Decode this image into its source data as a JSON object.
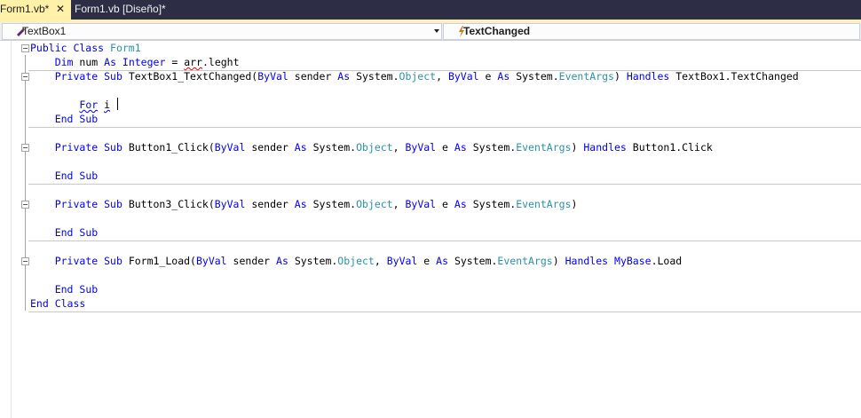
{
  "tabs": [
    {
      "label": "Form1.vb*",
      "active": true,
      "close": "✕"
    },
    {
      "label": "Form1.vb [Diseño]*",
      "active": false
    }
  ],
  "navbar": {
    "object_combo": "TextBox1",
    "event_combo": "TextChanged"
  },
  "colors": {
    "tab_active": "#fff1a8",
    "tabstrip": "#2d2d45",
    "keyword": "#0000ff",
    "type": "#2b91af"
  },
  "code": {
    "l1": {
      "kw": "Public Class",
      "ty": "Form1"
    },
    "l2": {
      "kw1": "Dim",
      "id1": "num",
      "kw2": "As Integer",
      "eq": "=",
      "err": "arr",
      "id2": ".leght"
    },
    "l3": {
      "kw1": "Private Sub",
      "id1": "TextBox1_TextChanged(",
      "kw2": "ByVal",
      "id2": "sender",
      "kw3": "As",
      "id3": "System.",
      "ty1": "Object",
      "p1": ",",
      "kw4": "ByVal",
      "id4": "e",
      "kw5": "As",
      "id5": "System.",
      "ty2": "EventArgs",
      "p2": ")",
      "kw6": "Handles",
      "id6": "TextBox1.TextChanged"
    },
    "l4": {
      "kw": "For",
      "id": "i"
    },
    "l5": {
      "kw": "End Sub"
    },
    "l6": {
      "kw1": "Private Sub",
      "id1": "Button1_Click(",
      "kw2": "ByVal",
      "id2": "sender",
      "kw3": "As",
      "id3": "System.",
      "ty1": "Object",
      "p1": ",",
      "kw4": "ByVal",
      "id4": "e",
      "kw5": "As",
      "id5": "System.",
      "ty2": "EventArgs",
      "p2": ")",
      "kw6": "Handles",
      "id6": "Button1.Click"
    },
    "l7": {
      "kw": "End Sub"
    },
    "l8": {
      "kw1": "Private Sub",
      "id1": "Button3_Click(",
      "kw2": "ByVal",
      "id2": "sender",
      "kw3": "As",
      "id3": "System.",
      "ty1": "Object",
      "p1": ",",
      "kw4": "ByVal",
      "id4": "e",
      "kw5": "As",
      "id5": "System.",
      "ty2": "EventArgs",
      "p2": ")"
    },
    "l9": {
      "kw": "End Sub"
    },
    "l10": {
      "kw1": "Private Sub",
      "id1": "Form1_Load(",
      "kw2": "ByVal",
      "id2": "sender",
      "kw3": "As",
      "id3": "System.",
      "ty1": "Object",
      "p1": ",",
      "kw4": "ByVal",
      "id4": "e",
      "kw5": "As",
      "id5": "System.",
      "ty2": "EventArgs",
      "p2": ")",
      "kw6": "Handles",
      "kw7": "MyBase",
      "id6": ".Load"
    },
    "l11": {
      "kw": "End Sub"
    },
    "l12": {
      "kw": "End Class"
    }
  }
}
